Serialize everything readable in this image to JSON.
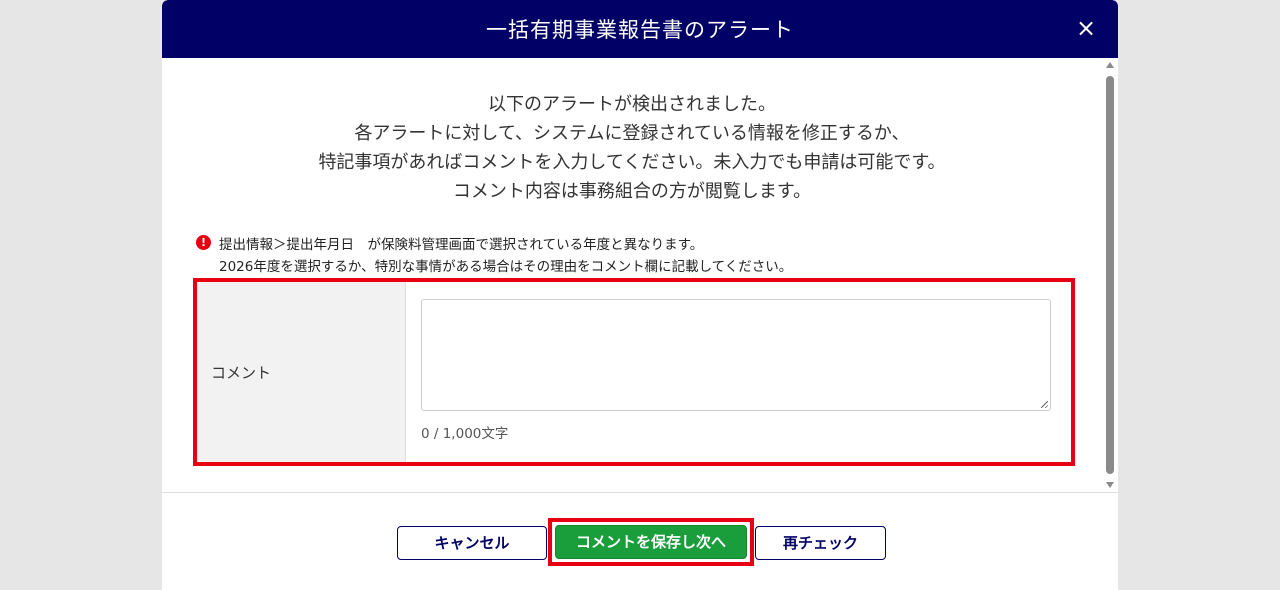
{
  "modal": {
    "title": "一括有期事業報告書のアラート",
    "close_glyph": "×"
  },
  "intro": {
    "lines": [
      "以下のアラートが検出されました。",
      "各アラートに対して、システムに登録されている情報を修正するか、",
      "特記事項があればコメントを入力してください。未入力でも申請は可能です。",
      "コメント内容は事務組合の方が閲覧します。"
    ]
  },
  "alert": {
    "icon": "exclamation-circle-icon",
    "icon_glyph": "!",
    "line1": "提出情報＞提出年月日　が保険料管理画面で選択されている年度と異なります。",
    "line2": "2026年度を選択するか、特別な事情がある場合はその理由をコメント欄に記載してください。",
    "color": "#e60012"
  },
  "comment": {
    "label": "コメント",
    "value": "",
    "char_count": "0 / 1,000文字"
  },
  "footer": {
    "cancel_label": "キャンセル",
    "save_label": "コメントを保存し次へ",
    "recheck_label": "再チェック"
  },
  "colors": {
    "header_bg": "#000066",
    "highlight_border": "#e60012",
    "save_button": "#1a9e3c"
  }
}
